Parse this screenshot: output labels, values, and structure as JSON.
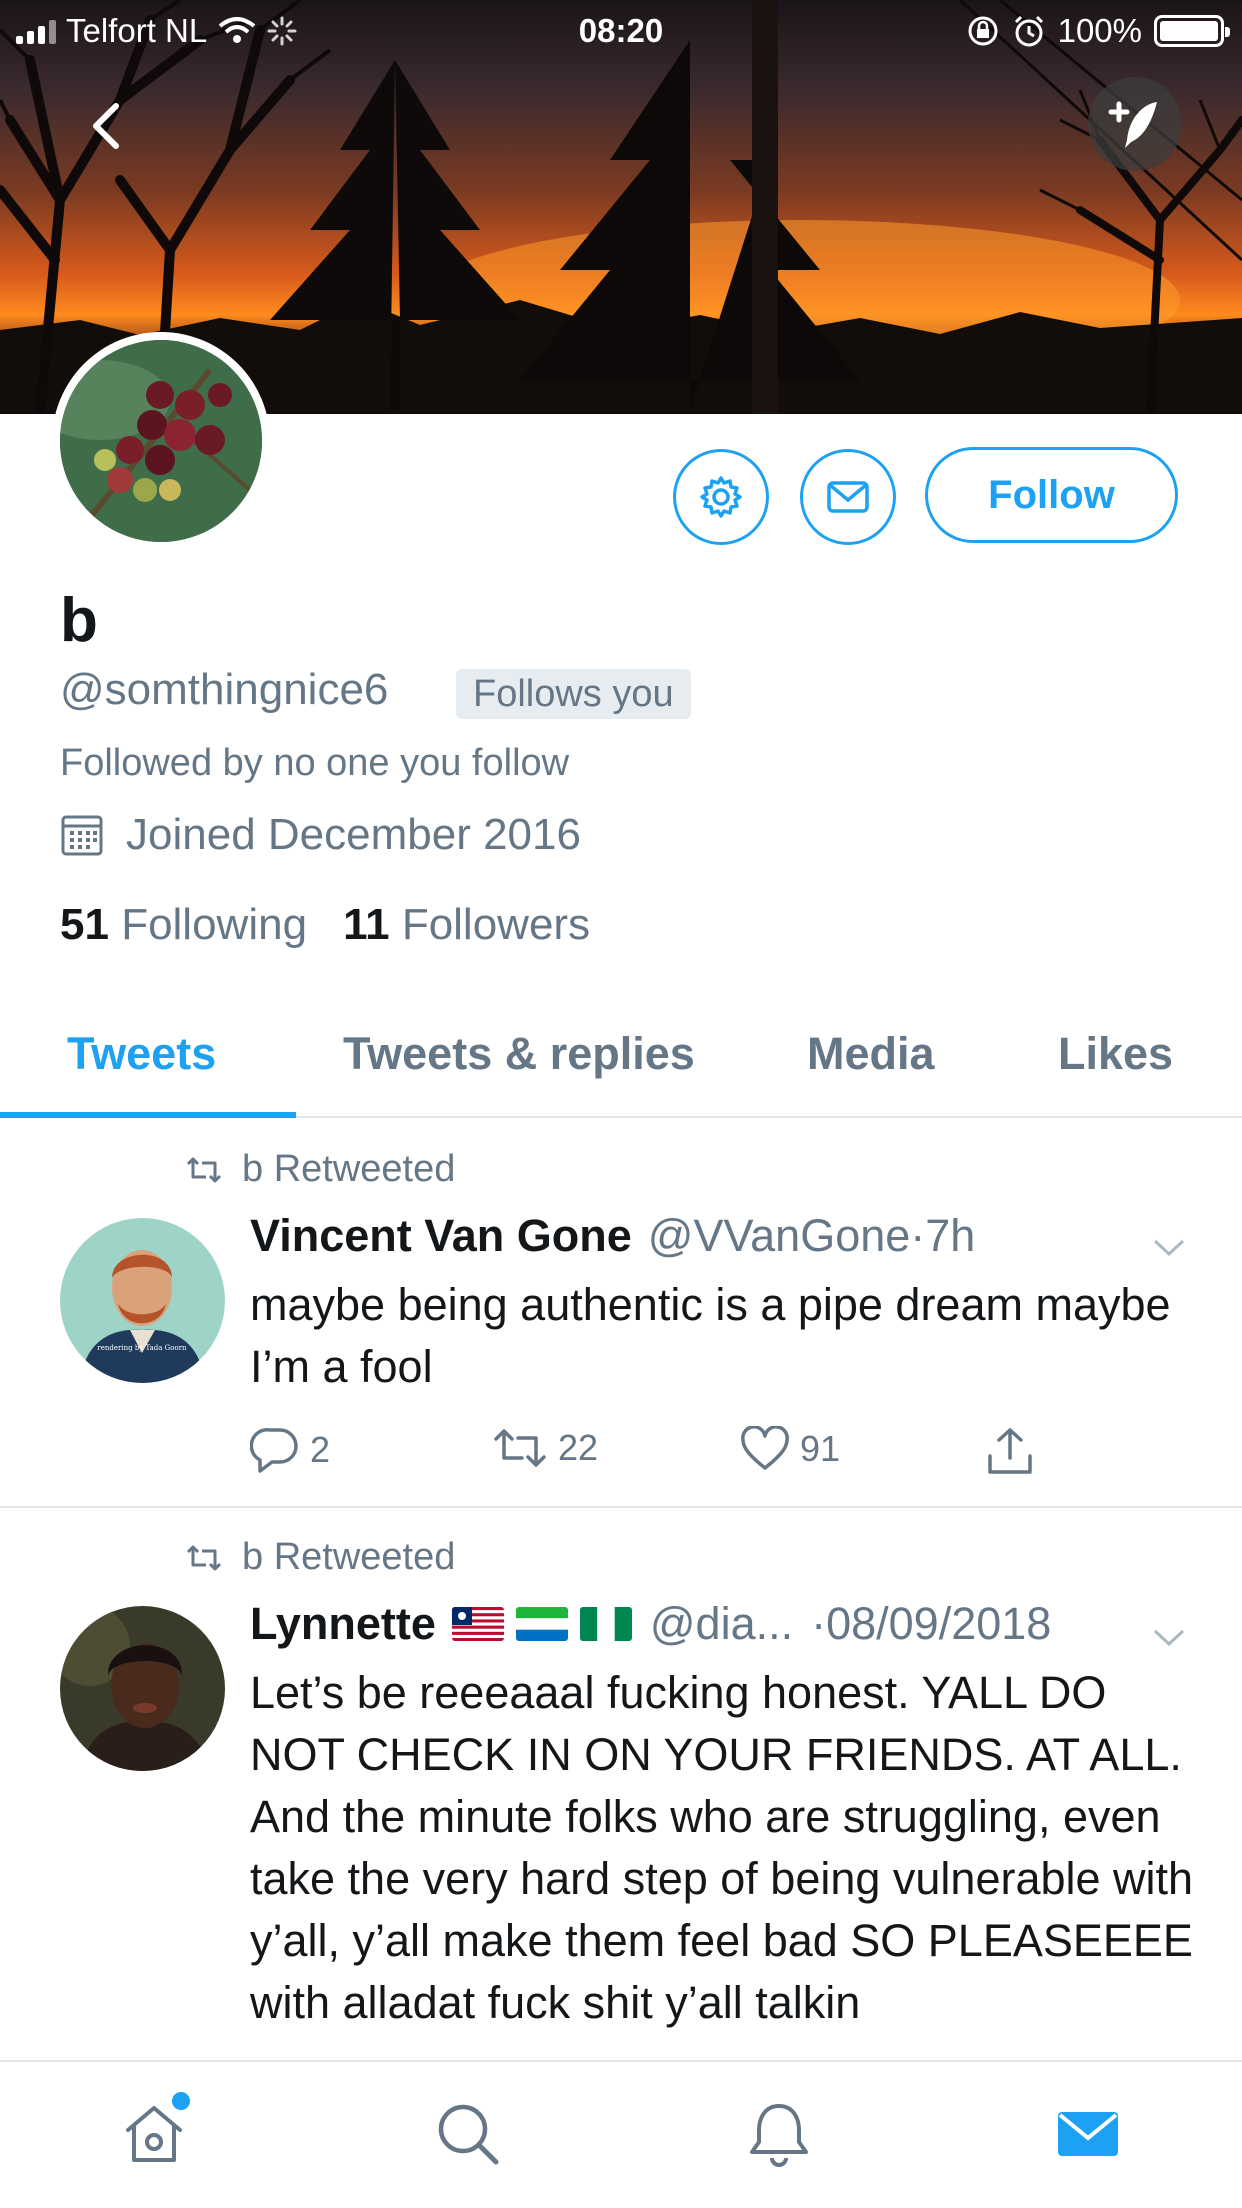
{
  "status_bar": {
    "carrier": "Telfort NL",
    "time": "08:20",
    "battery": "100%"
  },
  "profile": {
    "name": "b",
    "handle": "@somthingnice6",
    "follows_you_badge": "Follows you",
    "followed_by": "Followed by no one you follow",
    "joined": "Joined December 2016",
    "following_count": "51",
    "following_label": "Following",
    "followers_count": "11",
    "followers_label": "Followers",
    "follow_button": "Follow"
  },
  "tabs": [
    {
      "label": "Tweets",
      "active": true
    },
    {
      "label": "Tweets & replies",
      "active": false
    },
    {
      "label": "Media",
      "active": false
    },
    {
      "label": "Likes",
      "active": false
    }
  ],
  "tweets": [
    {
      "retweeted_by": "b Retweeted",
      "name": "Vincent Van Gone",
      "handle": "@VVanGone",
      "time": "·7h",
      "text": "maybe being authentic is a pipe dream maybe I’m a fool",
      "avatar_caption": "rendering by Tada Goorn",
      "replies": "2",
      "retweets": "22",
      "likes": "91"
    },
    {
      "retweeted_by": "b Retweeted",
      "name": "Lynnette",
      "handle": "@dia...",
      "time": "·08/09/2018",
      "text": "Let’s be reeeaaal fucking honest. YALL DO NOT CHECK IN ON YOUR FRIENDS. AT ALL. And the minute folks who are struggling, even take the very hard step of being vulnerable with y’all, y’all make them feel bad SO PLEASEEEE with alladat fuck shit y’all talkin"
    }
  ],
  "colors": {
    "accent": "#1da1f2",
    "secondary_text": "#657786",
    "primary_text": "#14171a"
  },
  "icons": [
    "back-arrow-icon",
    "compose-tweet-icon",
    "gear-icon",
    "mail-icon",
    "calendar-icon",
    "retweet-icon",
    "chevron-down-icon",
    "reply-icon",
    "like-icon",
    "share-icon",
    "home-icon",
    "search-icon",
    "bell-icon",
    "messages-icon"
  ]
}
